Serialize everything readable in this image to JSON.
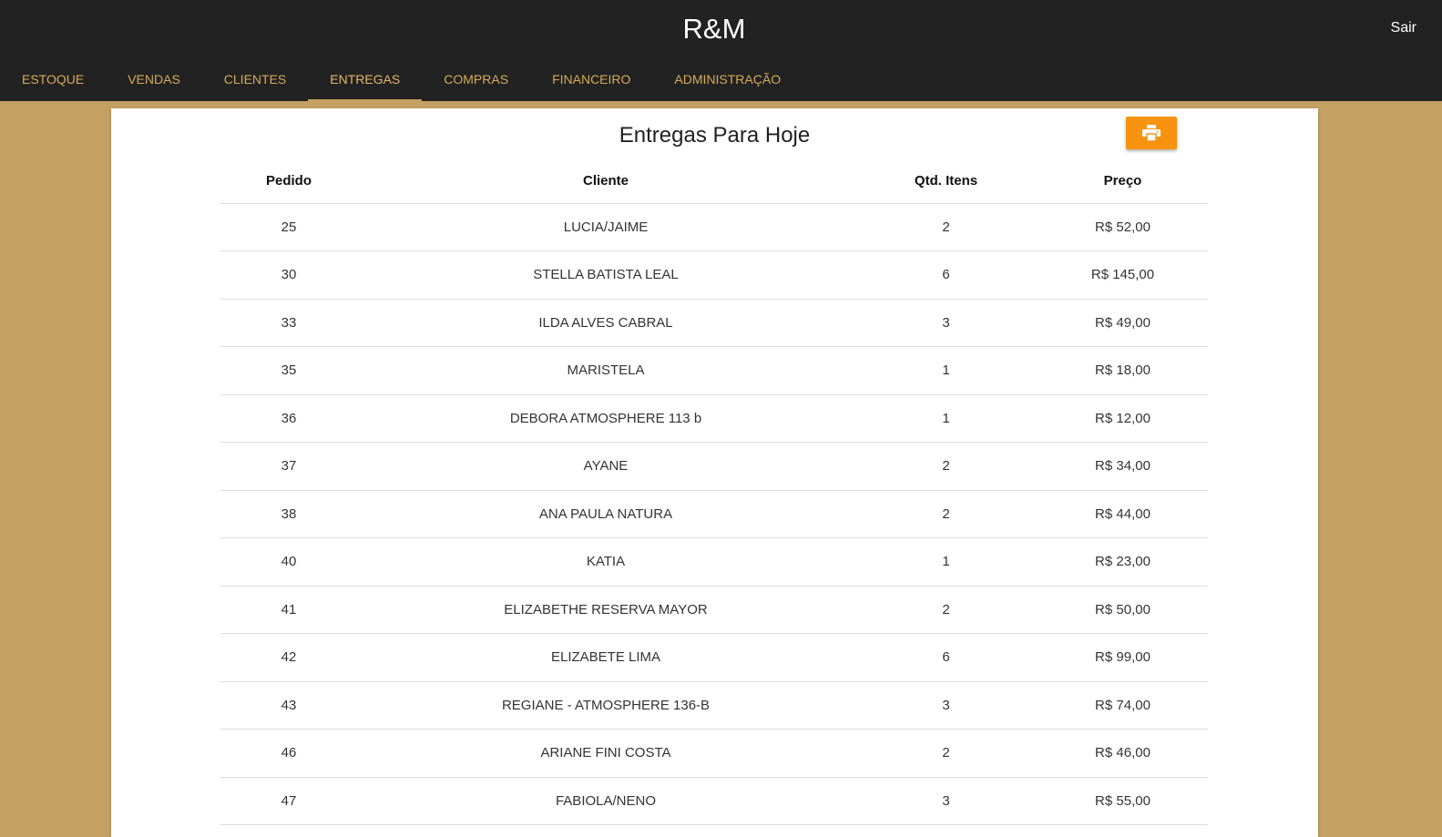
{
  "app": {
    "brand": "R&M",
    "logout_label": "Sair"
  },
  "nav": {
    "tabs": [
      {
        "label": "ESTOQUE"
      },
      {
        "label": "VENDAS"
      },
      {
        "label": "CLIENTES"
      },
      {
        "label": "ENTREGAS",
        "active": true
      },
      {
        "label": "COMPRAS"
      },
      {
        "label": "FINANCEIRO"
      },
      {
        "label": "ADMINISTRAÇÃO"
      }
    ]
  },
  "main": {
    "title": "Entregas Para Hoje",
    "print_icon": "printer-icon",
    "accent_color": "#f7930f",
    "columns": [
      "Pedido",
      "Cliente",
      "Qtd. Itens",
      "Preço"
    ],
    "rows": [
      [
        "25",
        "LUCIA/JAIME",
        "2",
        "R$ 52,00"
      ],
      [
        "30",
        "STELLA BATISTA LEAL",
        "6",
        "R$ 145,00"
      ],
      [
        "33",
        "ILDA ALVES CABRAL",
        "3",
        "R$ 49,00"
      ],
      [
        "35",
        "MARISTELA",
        "1",
        "R$ 18,00"
      ],
      [
        "36",
        "DEBORA ATMOSPHERE 113 b",
        "1",
        "R$ 12,00"
      ],
      [
        "37",
        "AYANE",
        "2",
        "R$ 34,00"
      ],
      [
        "38",
        "ANA PAULA NATURA",
        "2",
        "R$ 44,00"
      ],
      [
        "40",
        "KATIA",
        "1",
        "R$ 23,00"
      ],
      [
        "41",
        "ELIZABETHE RESERVA MAYOR",
        "2",
        "R$ 50,00"
      ],
      [
        "42",
        "ELIZABETE LIMA",
        "6",
        "R$ 99,00"
      ],
      [
        "43",
        "REGIANE - ATMOSPHERE 136-B",
        "3",
        "R$ 74,00"
      ],
      [
        "46",
        "ARIANE FINI COSTA",
        "2",
        "R$ 46,00"
      ],
      [
        "47",
        "FABIOLA/NENO",
        "3",
        "R$ 55,00"
      ]
    ]
  }
}
